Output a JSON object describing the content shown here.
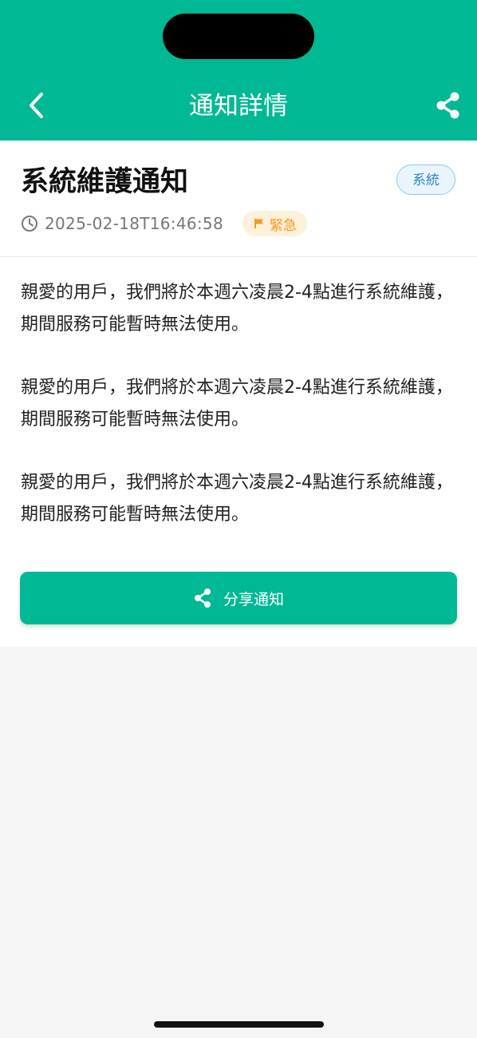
{
  "header": {
    "title": "通知詳情",
    "back_icon": "chevron-left-icon",
    "share_icon": "share-icon",
    "background_color": "#00b894"
  },
  "notice": {
    "title": "系統維護通知",
    "category": "系統",
    "timestamp": "2025-02-18T16:46:58",
    "priority": "緊急",
    "clock_icon": "clock-icon",
    "flag_icon": "flag-icon",
    "paragraphs": [
      "親愛的用戶，我們將於本週六凌晨2-4點進行系統維護，期間服務可能暫時無法使用。",
      "親愛的用戶，我們將於本週六凌晨2-4點進行系統維護，期間服務可能暫時無法使用。",
      "親愛的用戶，我們將於本週六凌晨2-4點進行系統維護，期間服務可能暫時無法使用。"
    ]
  },
  "share_button": {
    "label": "分享通知",
    "icon": "share-icon"
  },
  "colors": {
    "accent": "#00b894",
    "category_badge": "#2a86c9",
    "priority_badge": "#f29b1d"
  }
}
